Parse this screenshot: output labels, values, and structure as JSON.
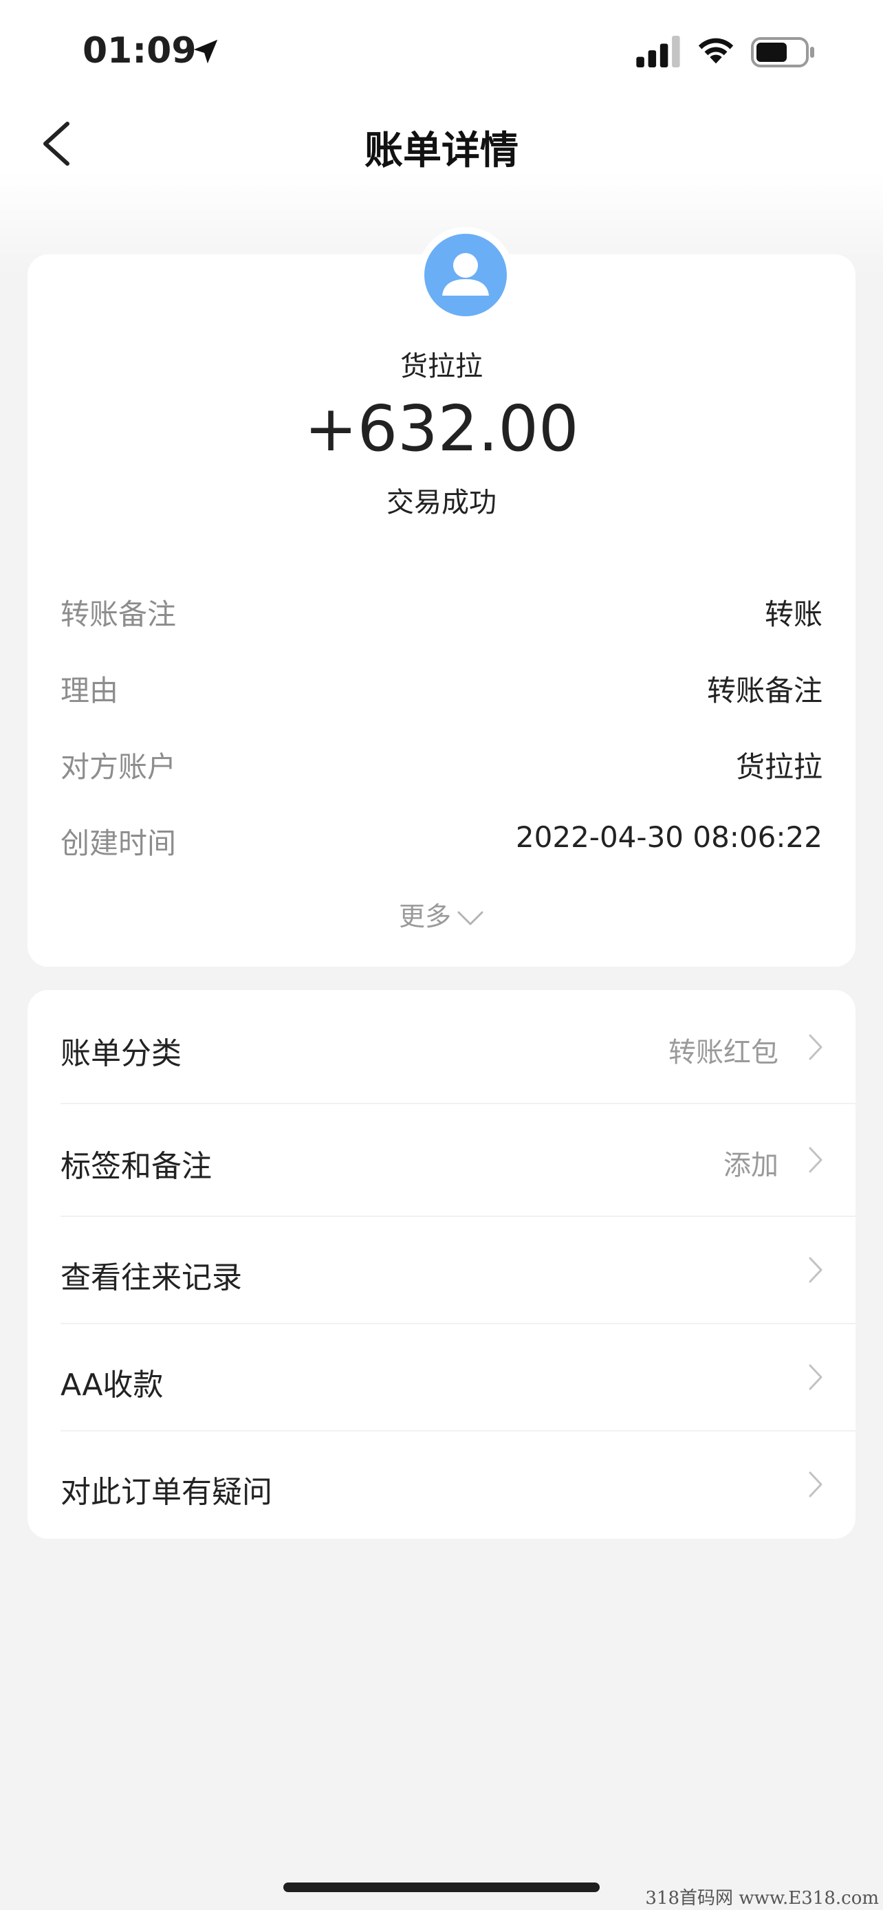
{
  "status_bar": {
    "time": "01:09",
    "icons": [
      "location-arrow-icon",
      "cellular-signal-icon",
      "wifi-icon",
      "battery-icon"
    ]
  },
  "nav": {
    "title": "账单详情",
    "back_icon": "chevron-left-icon"
  },
  "summary": {
    "payee": "货拉拉",
    "amount": "+632.00",
    "status": "交易成功",
    "avatar_icon": "user-avatar-icon",
    "avatar_color": "#6aaef6",
    "details": [
      {
        "label": "转账备注",
        "value": "转账"
      },
      {
        "label": "理由",
        "value": "转账备注"
      },
      {
        "label": "对方账户",
        "value": "货拉拉"
      },
      {
        "label": "创建时间",
        "value": "2022-04-30 08:06:22"
      }
    ],
    "more_label": "更多"
  },
  "actions": [
    {
      "label": "账单分类",
      "value": "转账红包"
    },
    {
      "label": "标签和备注",
      "value": "添加"
    },
    {
      "label": "查看往来记录",
      "value": ""
    },
    {
      "label": "AA收款",
      "value": ""
    },
    {
      "label": "对此订单有疑问",
      "value": ""
    }
  ],
  "watermark": "318首码网 www.E318.com"
}
